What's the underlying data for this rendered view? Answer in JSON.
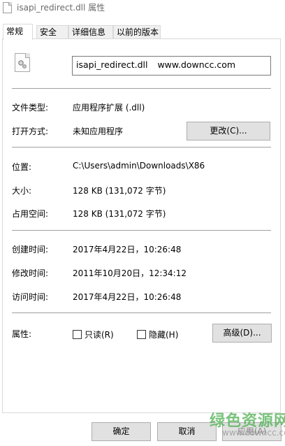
{
  "window": {
    "title": "isapi_redirect.dll 属性"
  },
  "tabs": [
    {
      "label": "常规"
    },
    {
      "label": "安全"
    },
    {
      "label": "详细信息"
    },
    {
      "label": "以前的版本"
    }
  ],
  "general": {
    "filename_field": {
      "name": "isapi_redirect.dll",
      "extra": "www.downcc.com"
    },
    "file_type": {
      "label": "文件类型:",
      "value": "应用程序扩展 (.dll)"
    },
    "opens_with": {
      "label": "打开方式:",
      "value": "未知应用程序",
      "change_button": "更改(C)..."
    },
    "location": {
      "label": "位置:",
      "value": "C:\\Users\\admin\\Downloads\\X86"
    },
    "size": {
      "label": "大小:",
      "value": "128 KB (131,072 字节)"
    },
    "size_on_disk": {
      "label": "占用空间:",
      "value": "128 KB (131,072 字节)"
    },
    "created": {
      "label": "创建时间:",
      "value": "2017年4月22日，10:26:48"
    },
    "modified": {
      "label": "修改时间:",
      "value": "2011年10月20日，12:34:12"
    },
    "accessed": {
      "label": "访问时间:",
      "value": "2017年4月22日，10:26:48"
    },
    "attributes": {
      "label": "属性:",
      "readonly": {
        "label": "只读(R)",
        "checked": false
      },
      "hidden": {
        "label": "隐藏(H)",
        "checked": false
      },
      "advanced_button": "高级(D)..."
    }
  },
  "footer": {
    "ok": "确定",
    "cancel": "取消",
    "apply": "应用(A)"
  },
  "watermark": {
    "text": "绿色资源网",
    "url": "www.downcc.com"
  },
  "icons": {
    "title_file_icon": "file-icon",
    "big_file_icon": "dll-file-gear-icon"
  }
}
